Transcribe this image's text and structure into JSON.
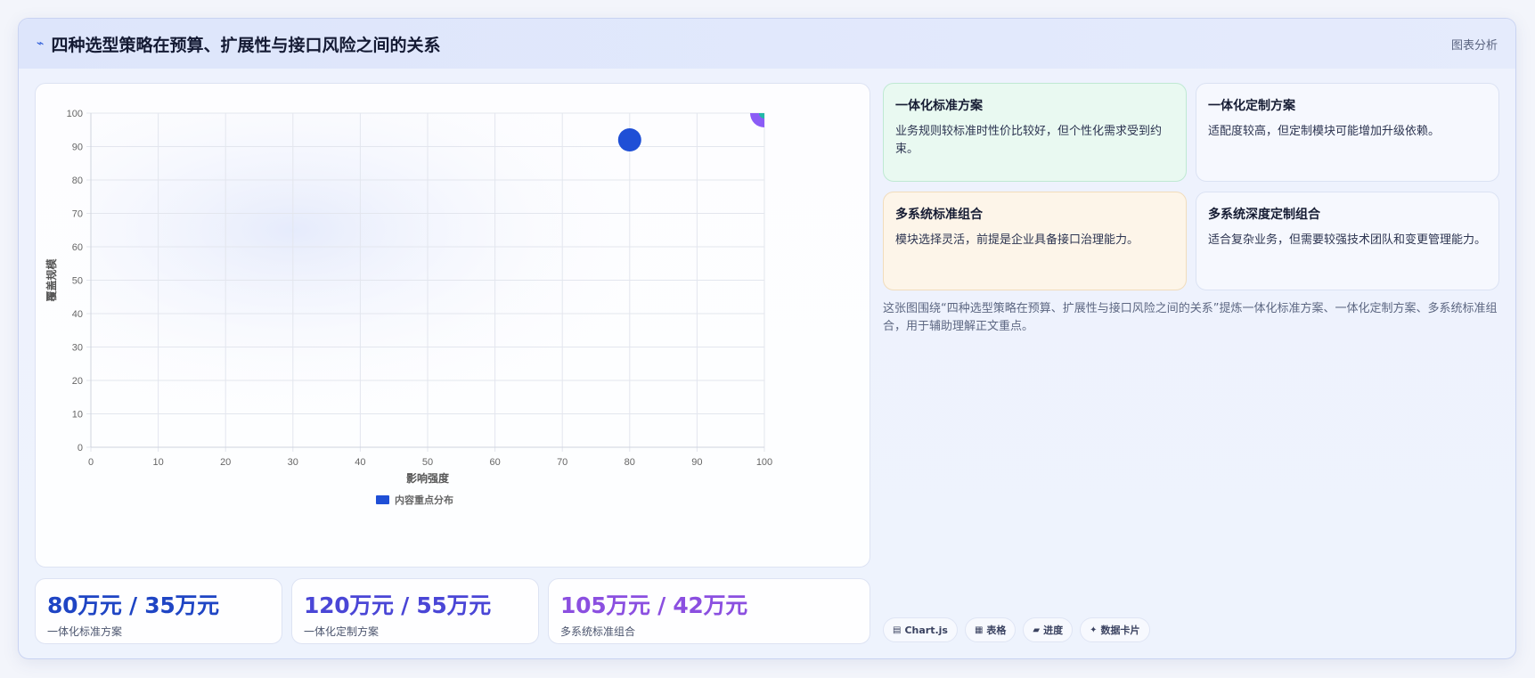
{
  "header": {
    "icon": "zap-icon",
    "title": "四种选型策略在预算、扩展性与接口风险之间的关系",
    "right_label": "图表分析"
  },
  "chart_data": {
    "type": "scatter",
    "title": "",
    "xlabel": "影响强度",
    "ylabel": "覆盖规模",
    "xlim": [
      0,
      100
    ],
    "ylim": [
      0,
      100
    ],
    "x_ticks": [
      "0",
      "10",
      "20",
      "30",
      "40",
      "50",
      "60",
      "70",
      "80",
      "90",
      "100"
    ],
    "y_ticks": [
      "0",
      "10",
      "20",
      "30",
      "40",
      "50",
      "60",
      "70",
      "80",
      "90",
      "100"
    ],
    "grid": true,
    "legend_position": "bottom",
    "legend": [
      "内容重点分布"
    ],
    "series": [
      {
        "name": "内容重点分布",
        "points": [
          {
            "x": 80,
            "y": 92,
            "color": "#1f4fd6"
          },
          {
            "x": 100,
            "y": 100,
            "color": "#8b5cf6"
          },
          {
            "x": 100,
            "y": 100,
            "color": "#22b8a8"
          }
        ]
      }
    ]
  },
  "kpis": [
    {
      "value": "80万元 / 35万元",
      "label": "一体化标准方案",
      "color": "#1f45c4"
    },
    {
      "value": "120万元 / 55万元",
      "label": "一体化定制方案",
      "color": "#4a46d6"
    },
    {
      "value": "105万元 / 42万元",
      "label": "多系统标准组合",
      "color": "#8b4fe0"
    }
  ],
  "tiles": [
    {
      "title": "一体化标准方案",
      "desc": "业务规则较标准时性价比较好，但个性化需求受到约束。",
      "bg": "#e9f9f1",
      "border": "#bfe9d3"
    },
    {
      "title": "一体化定制方案",
      "desc": "适配度较高，但定制模块可能增加升级依赖。",
      "bg": "#f6f8fe",
      "border": "#dbe2f3"
    },
    {
      "title": "多系统标准组合",
      "desc": "模块选择灵活，前提是企业具备接口治理能力。",
      "bg": "#fdf5e9",
      "border": "#f1dcbc"
    },
    {
      "title": "多系统深度定制组合",
      "desc": "适合复杂业务，但需要较强技术团队和变更管理能力。",
      "bg": "#f6f8fe",
      "border": "#dbe2f3"
    }
  ],
  "description": "这张图围绕“四种选型策略在预算、扩展性与接口风险之间的关系”提炼一体化标准方案、一体化定制方案、多系统标准组合，用于辅助理解正文重点。",
  "tags": [
    {
      "icon": "chart-icon",
      "glyph": "▤",
      "label": "Chart.js"
    },
    {
      "icon": "table-icon",
      "glyph": "▦",
      "label": "表格"
    },
    {
      "icon": "progress-icon",
      "glyph": "▰",
      "label": "进度"
    },
    {
      "icon": "data-card-icon",
      "glyph": "✦",
      "label": "数据卡片"
    }
  ]
}
